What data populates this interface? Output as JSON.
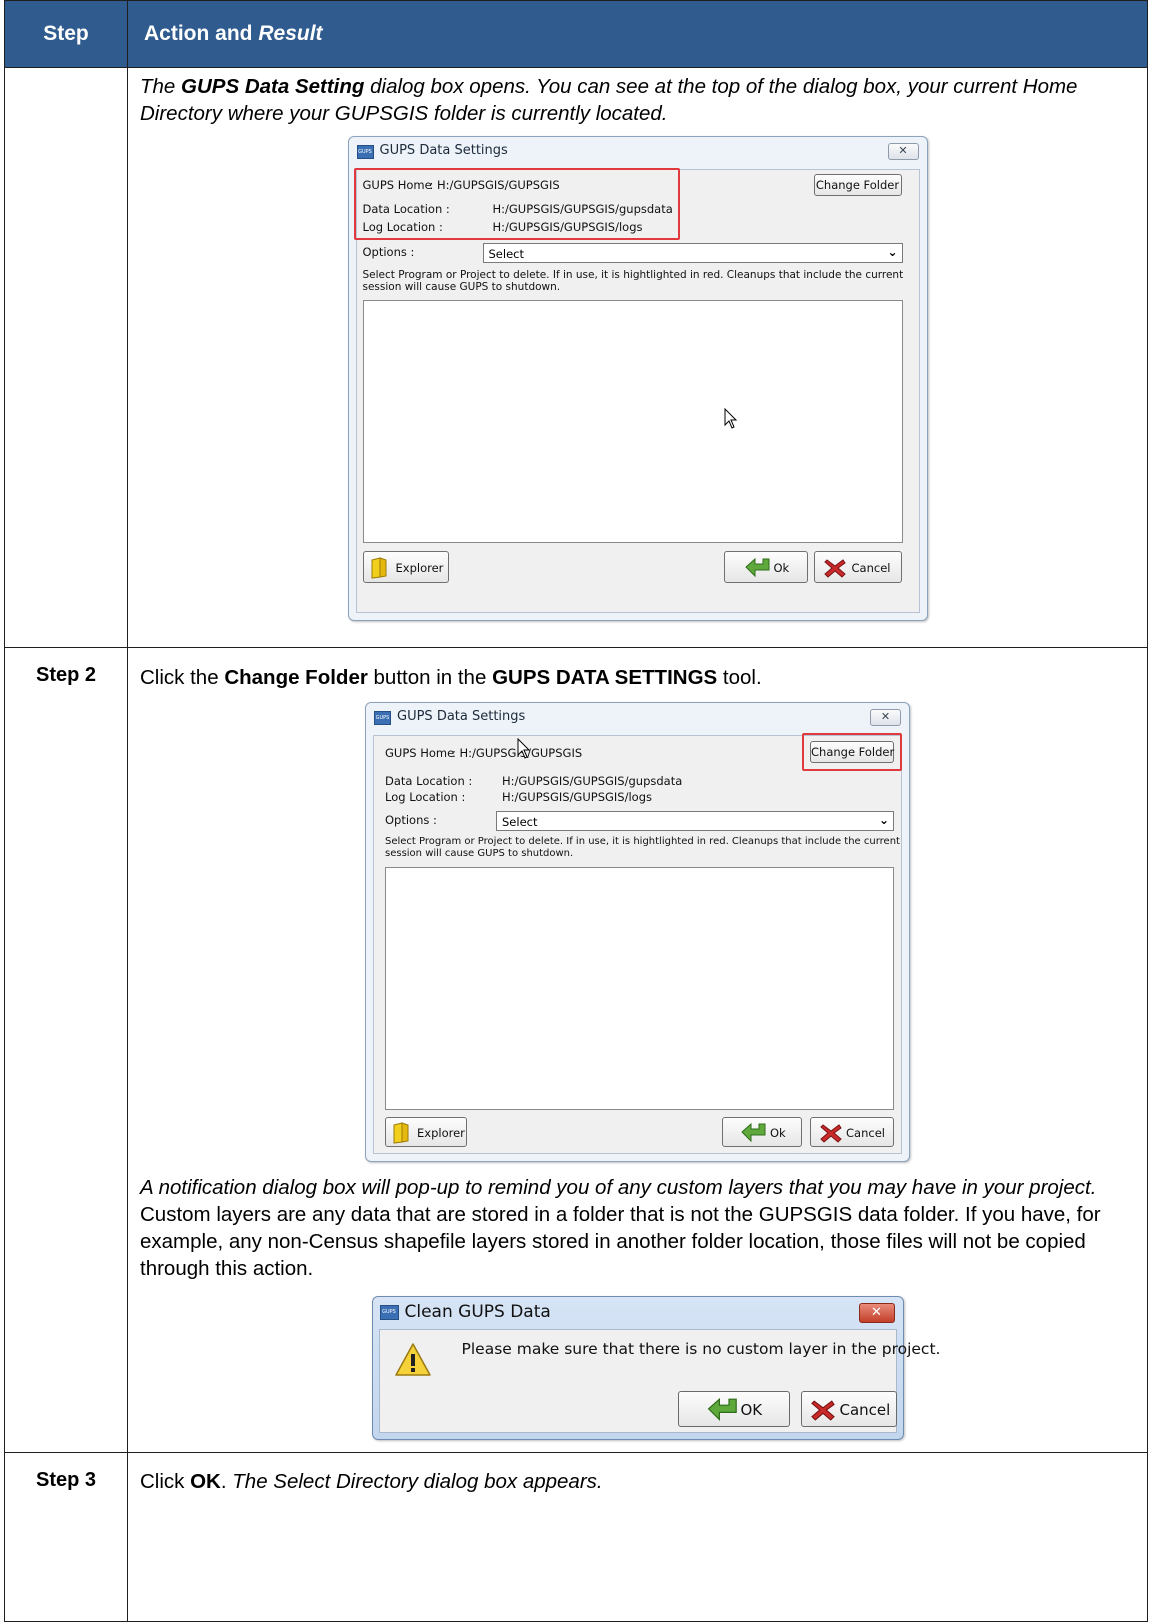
{
  "table": {
    "header": {
      "step": "Step",
      "action_prefix": "Action and ",
      "action_result": "Result"
    }
  },
  "row1": {
    "para": {
      "p1": "The ",
      "p2": "GUPS Data Setting",
      "p3": " dialog box opens. You can see at the top of the dialog box, your current Home Directory where your GUPSGIS folder is currently located."
    }
  },
  "dialog1": {
    "title": "GUPS Data Settings",
    "app_icon_text": "GUPS",
    "close_glyph": "✕",
    "gups_home_label": "GUPS Home",
    "gups_home_value": ": H:/GUPSGIS/GUPSGIS",
    "data_location_label": "Data Location   :",
    "data_location_value": "H:/GUPSGIS/GUPSGIS/gupsdata",
    "log_location_label": "Log Location    :",
    "log_location_value": "H:/GUPSGIS/GUPSGIS/logs",
    "options_label": "Options :",
    "options_selected": "Select",
    "instruction_line1": "Select Program or Project to delete. If in use, it is hightlighted in red. Cleanups that include the current",
    "instruction_line2": "session will cause GUPS to shutdown.",
    "change_folder": "Change Folder",
    "explorer": "Explorer",
    "ok": "Ok",
    "cancel": "Cancel",
    "highlight_color": "#e0393e"
  },
  "row2": {
    "step": "Step 2",
    "para": {
      "p1": "Click the ",
      "p2": "Change Folder",
      "p3": " button in the ",
      "p4": "GUPS DATA SETTINGS",
      "p5": " tool."
    },
    "note": {
      "n1": "A notification dialog box will pop-up to remind you of any custom layers that you may have in your project.",
      "n2": " Custom layers are any data that are stored in a folder that is not the GUPSGIS data folder. If you have, for example, any non-Census shapefile layers stored in another folder location, those files will not be copied through this action."
    }
  },
  "dialog2": {
    "title": "GUPS Data Settings",
    "app_icon_text": "GUPS",
    "close_glyph": "✕",
    "gups_home_label": "GUPS Home",
    "gups_home_value": ": H:/GUPSGIS/GUPSGIS",
    "data_location_label": "Data Location   :",
    "data_location_value": "H:/GUPSGIS/GUPSGIS/gupsdata",
    "log_location_label": "Log Location    :",
    "log_location_value": "H:/GUPSGIS/GUPSGIS/logs",
    "options_label": "Options :",
    "options_selected": "Select",
    "instruction_line1": "Select Program or Project to delete. If in use, it is hightlighted in red. Cleanups that include the current",
    "instruction_line2": "session will cause GUPS to shutdown.",
    "change_folder": "Change Folder",
    "explorer": "Explorer",
    "ok": "Ok",
    "cancel": "Cancel"
  },
  "dialog3": {
    "title": "Clean GUPS Data",
    "app_icon_text": "GUPS",
    "close_glyph": "✕",
    "message": "Please make sure that there is no custom layer in the project.",
    "ok": "OK",
    "cancel": "Cancel"
  },
  "row3": {
    "step": "Step 3",
    "para": {
      "p1": "Click ",
      "p2": "OK",
      "p3": ". ",
      "p4": "The Select Directory dialog box appears."
    }
  }
}
